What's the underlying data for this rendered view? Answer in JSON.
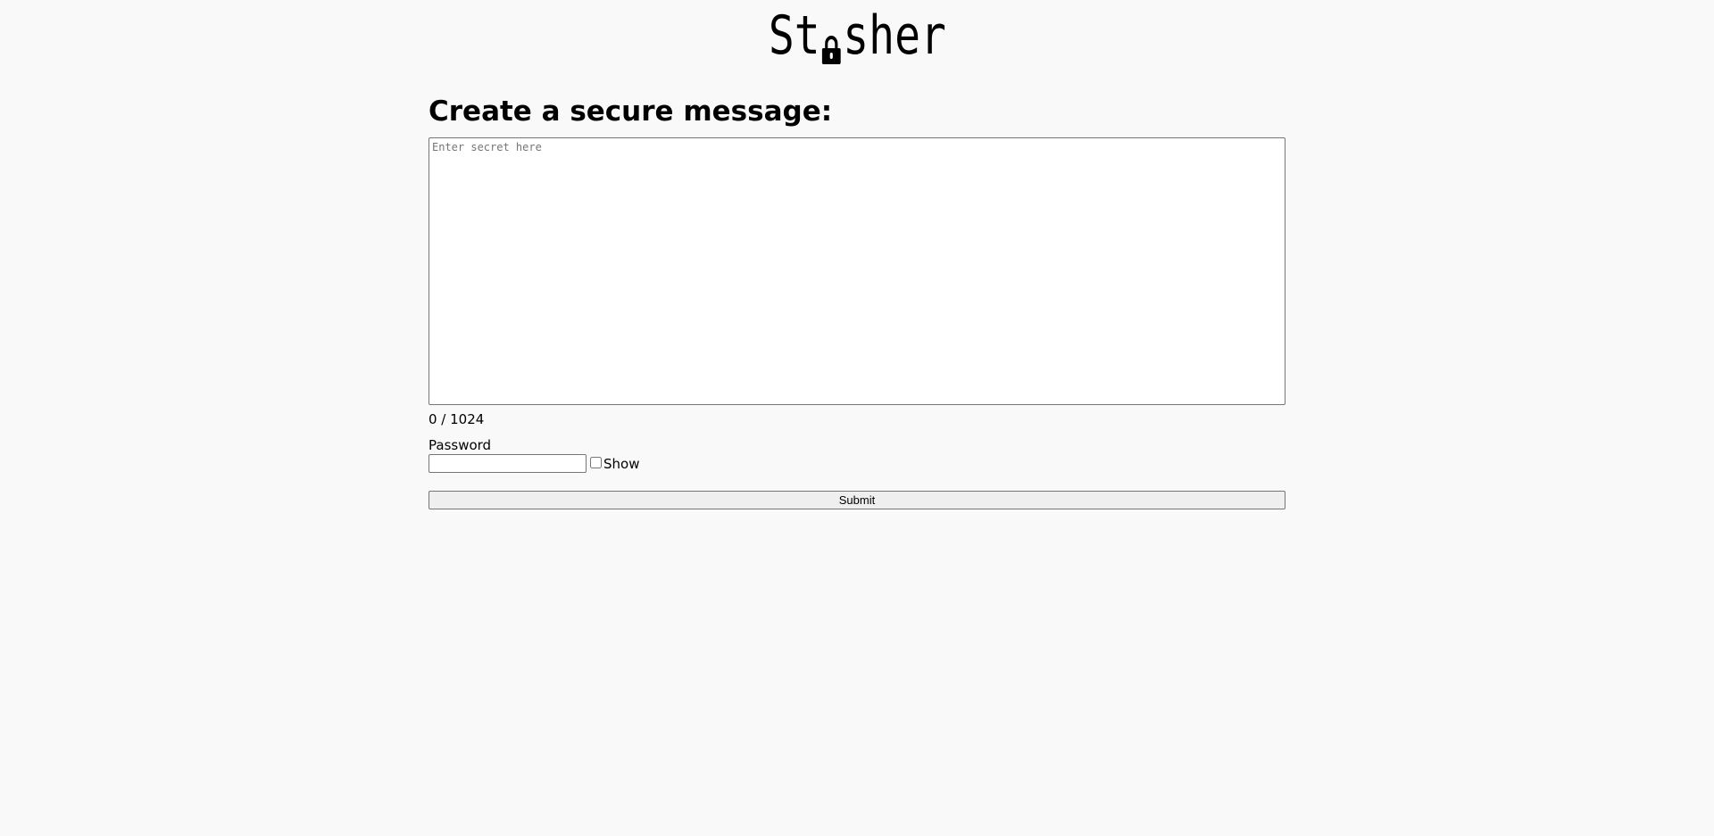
{
  "header": {
    "logo_left": "St",
    "logo_right": "sher"
  },
  "main": {
    "title": "Create a secure message:",
    "secret_placeholder": "Enter secret here",
    "secret_value": "",
    "counter": "0 / 1024",
    "password_label": "Password",
    "password_value": "",
    "show_label": "Show",
    "show_checked": false,
    "submit_label": "Submit"
  },
  "colors": {
    "background": "#f9f9f9",
    "field_border": "#767676",
    "button_background": "#efefef"
  }
}
